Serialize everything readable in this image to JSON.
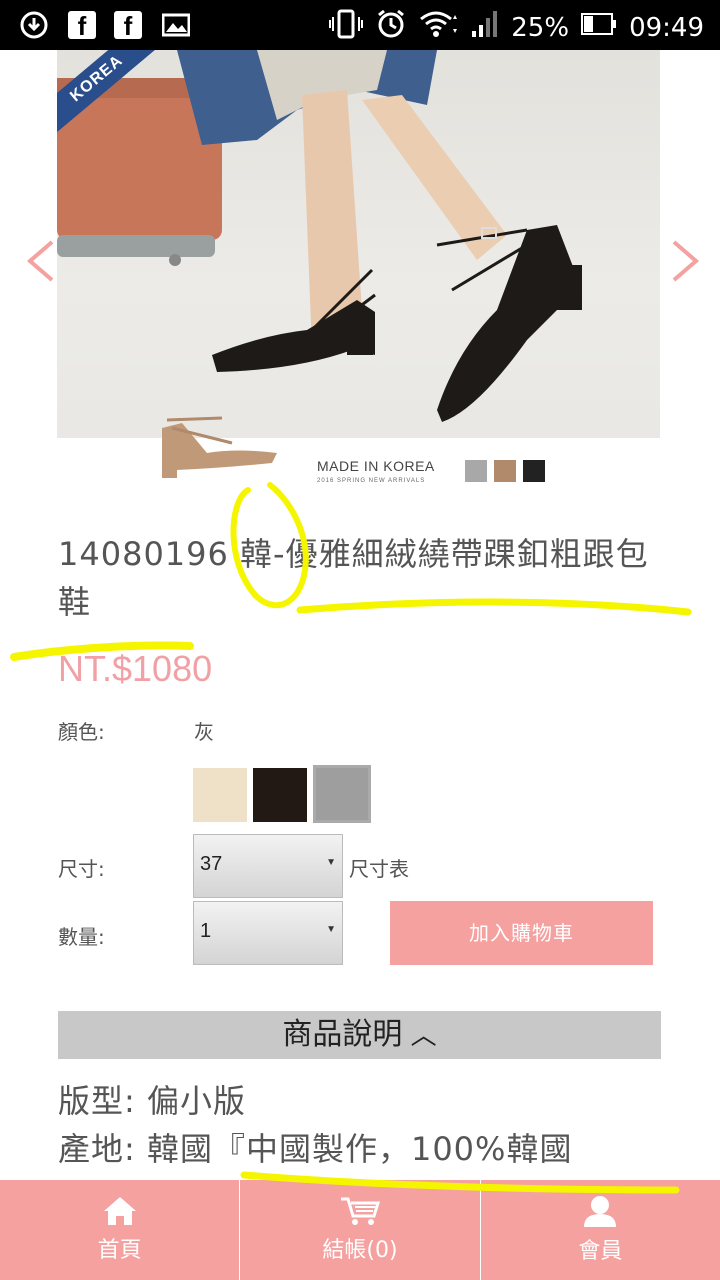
{
  "status_bar": {
    "battery": "25%",
    "time": "09:49"
  },
  "hero": {
    "badge": "KOREA",
    "made_in": "MADE IN KOREA",
    "season": "2016 SPRING  NEW ARRIVALS",
    "mini_swatches": [
      "#a8a8a8",
      "#b08a6a",
      "#222222"
    ]
  },
  "product": {
    "title": "14080196  韓-優雅細絨繞帶踝釦粗跟包鞋",
    "price": "NT.$1080",
    "color_label": "顏色:",
    "color_value": "灰",
    "swatches": [
      "#efe1c8",
      "#221915",
      "#9e9e9e"
    ],
    "size_label": "尺寸:",
    "size_value": "37",
    "size_chart": "尺寸表",
    "qty_label": "數量:",
    "qty_value": "1",
    "add_to_cart": "加入購物車"
  },
  "description": {
    "header": "商品說明",
    "fit": "版型: 偏小版",
    "origin": "產地: 韓國『中國製作，100%韓國"
  },
  "bottom_nav": {
    "home": "首頁",
    "checkout": "結帳(0)",
    "member": "會員"
  },
  "colors": {
    "accent_pink": "#f4a1a0",
    "price_pink": "#f1a0a5",
    "highlighter": "#f5f500"
  }
}
